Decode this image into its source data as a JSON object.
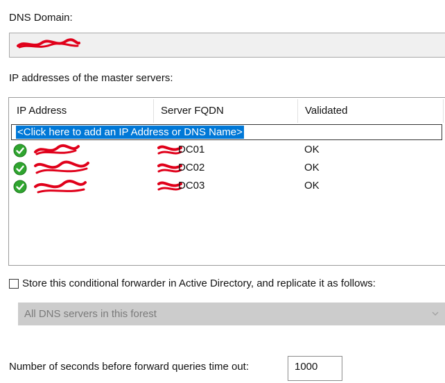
{
  "dns_domain": {
    "label": "DNS Domain:",
    "value": "[redacted]"
  },
  "master_servers": {
    "label": "IP addresses of the master servers:",
    "columns": [
      "IP Address",
      "Server FQDN",
      "Validated"
    ],
    "add_prompt": "<Click here to add an IP Address or DNS Name>",
    "rows": [
      {
        "ip": "[redacted]",
        "fqdn_visible": "DC01",
        "validated": "OK",
        "icon": "green-check-icon"
      },
      {
        "ip": "[redacted]",
        "fqdn_visible": "DC02",
        "validated": "OK",
        "icon": "green-check-icon"
      },
      {
        "ip": "[redacted]",
        "fqdn_visible": "DC03",
        "validated": "OK",
        "icon": "green-check-icon"
      }
    ]
  },
  "store_in_ad": {
    "label": "Store this conditional forwarder in Active Directory, and replicate it as follows:",
    "checked": false
  },
  "replication_scope": {
    "selected": "All DNS servers in this forest",
    "disabled": true
  },
  "timeout": {
    "label": "Number of seconds before forward queries time out:",
    "value": "1000"
  },
  "colors": {
    "selection": "#0078d7",
    "ok_green": "#2fa52f",
    "redaction": "#e0001a",
    "disabled_bg": "#cccccc"
  }
}
